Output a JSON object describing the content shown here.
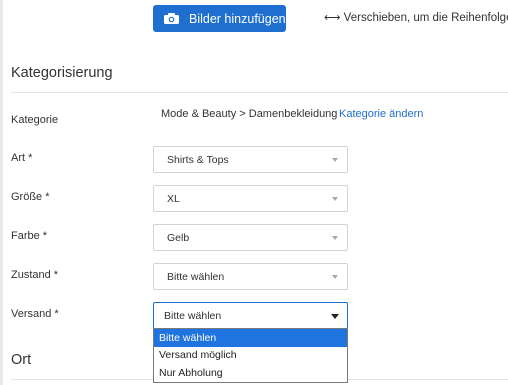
{
  "upload": {
    "button_label": "Bilder hinzufügen",
    "reorder_hint": "⟷ Verschieben, um die Reihenfolge zu"
  },
  "categorization": {
    "title": "Kategorisierung",
    "category_label": "Kategorie",
    "category_path": "Mode & Beauty > Damenbekleidung",
    "category_change": "Kategorie ändern",
    "fields": [
      {
        "label": "Art *",
        "value": "Shirts & Tops"
      },
      {
        "label": "Größe *",
        "value": "XL"
      },
      {
        "label": "Farbe *",
        "value": "Gelb"
      },
      {
        "label": "Zustand *",
        "value": "Bitte wählen"
      },
      {
        "label": "Versand *",
        "value": "Bitte wählen"
      }
    ],
    "shipping_options": [
      "Bitte wählen",
      "Versand möglich",
      "Nur Abholung"
    ],
    "shipping_selected_index": 0
  },
  "location": {
    "title": "Ort"
  },
  "colors": {
    "accent": "#1f6fd0",
    "highlight": "#1f74e0"
  }
}
